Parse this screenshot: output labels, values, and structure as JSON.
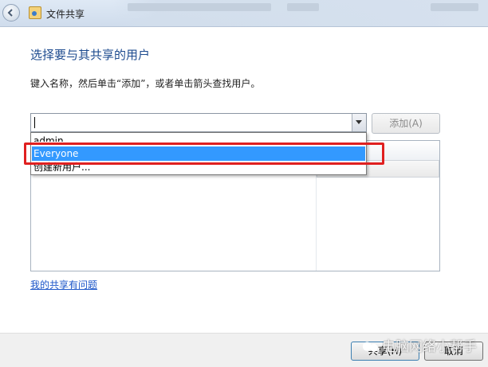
{
  "window": {
    "title": "文件共享"
  },
  "main": {
    "heading": "选择要与其共享的用户",
    "instruction": "键入名称，然后单击“添加”，或者单击箭头查找用户。",
    "combo_value": "",
    "add_button": "添加(A)",
    "dropdown_items": [
      "admin",
      "Everyone",
      "创建新用户..."
    ],
    "help_link": "我的共享有问题"
  },
  "footer": {
    "share_button": "共享(H)",
    "cancel_button": "取消"
  },
  "watermark": {
    "text": "电脑网络小帮手"
  },
  "colors": {
    "selected_item": "#3399ff",
    "highlight_box": "#e02020",
    "heading": "#1d4b8f",
    "link": "#1c56c9"
  }
}
